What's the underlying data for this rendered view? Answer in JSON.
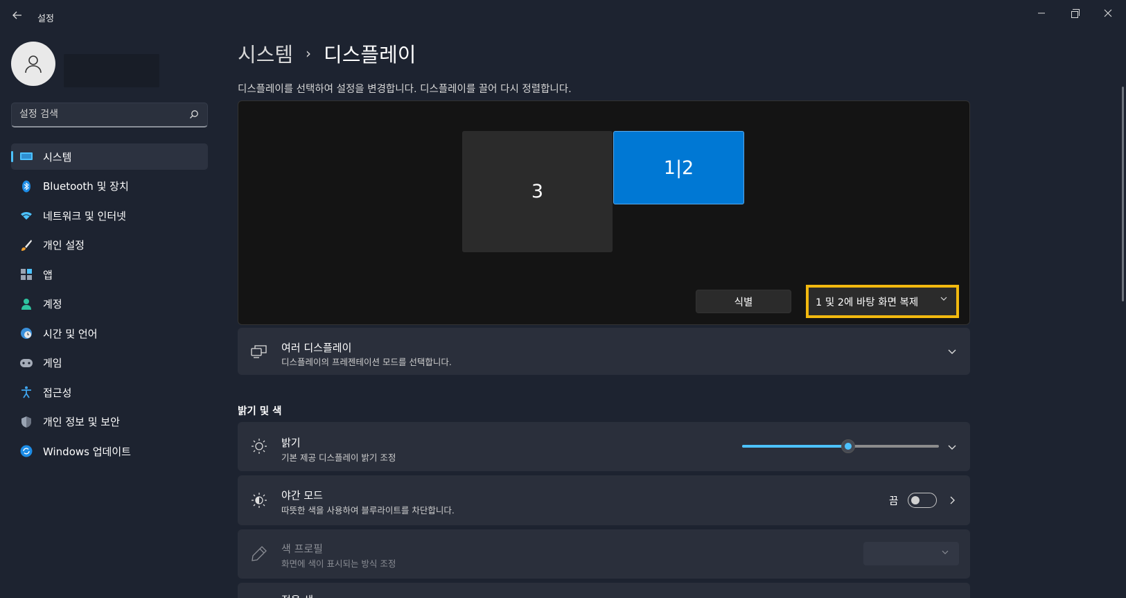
{
  "window": {
    "title": "설정",
    "back_icon": "back-arrow-icon",
    "controls": [
      "minimize-icon",
      "restore-icon",
      "close-icon"
    ]
  },
  "sidebar": {
    "search_placeholder": "설정 검색",
    "items": [
      {
        "label": "시스템",
        "icon": "system-monitor-icon",
        "active": true
      },
      {
        "label": "Bluetooth 및 장치",
        "icon": "bluetooth-icon"
      },
      {
        "label": "네트워크 및 인터넷",
        "icon": "wifi-icon"
      },
      {
        "label": "개인 설정",
        "icon": "brush-icon"
      },
      {
        "label": "앱",
        "icon": "apps-icon"
      },
      {
        "label": "계정",
        "icon": "account-icon"
      },
      {
        "label": "시간 및 언어",
        "icon": "time-language-icon"
      },
      {
        "label": "게임",
        "icon": "gamepad-icon"
      },
      {
        "label": "접근성",
        "icon": "accessibility-icon"
      },
      {
        "label": "개인 정보 및 보안",
        "icon": "shield-icon"
      },
      {
        "label": "Windows 업데이트",
        "icon": "update-icon"
      }
    ]
  },
  "main": {
    "breadcrumb_parent": "시스템",
    "breadcrumb_sep": "›",
    "page_title": "디스플레이",
    "description": "디스플레이를 선택하여 설정을 변경합니다. 디스플레이를 끌어 다시 정렬합니다.",
    "monitors": [
      {
        "label": "3"
      },
      {
        "label": "1|2",
        "selected": true
      }
    ],
    "identify_label": "식별",
    "mode_dropdown_value": "1 및 2에 바탕 화면 복제",
    "multi_display": {
      "title": "여러 디스플레이",
      "subtitle": "디스플레이의 프레젠테이션 모드를 선택합니다."
    },
    "section_brightness_color": "밝기 및 색",
    "brightness": {
      "title": "밝기",
      "subtitle": "기본 제공 디스플레이 밝기 조정",
      "level_percent": 54
    },
    "night_mode": {
      "title": "야간 모드",
      "subtitle": "따뜻한 색을 사용하여 블루라이트를 차단합니다.",
      "state_label": "끔",
      "on": false
    },
    "color_profile": {
      "title": "색 프로필",
      "subtitle": "화면에 색이 표시되는 방식 조정",
      "enabled": false
    },
    "next_partial_title": "적응 색"
  },
  "colors": {
    "accent": "#4cc2ff",
    "selected_monitor": "#0078d4",
    "highlight_border": "#f2b90f",
    "background": "#1d2330"
  }
}
